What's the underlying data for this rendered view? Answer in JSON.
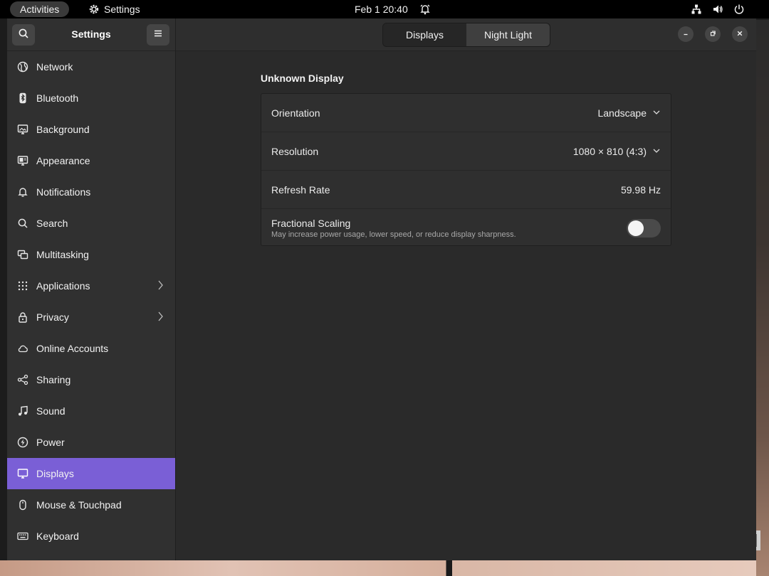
{
  "topbar": {
    "activities": "Activities",
    "app_name": "Settings",
    "clock": "Feb 1 20:40"
  },
  "sidebar": {
    "title": "Settings",
    "items": [
      {
        "label": "Network",
        "icon": "network-icon"
      },
      {
        "label": "Bluetooth",
        "icon": "bluetooth-icon"
      },
      {
        "label": "Background",
        "icon": "background-icon"
      },
      {
        "label": "Appearance",
        "icon": "appearance-icon"
      },
      {
        "label": "Notifications",
        "icon": "bell-icon"
      },
      {
        "label": "Search",
        "icon": "search-icon"
      },
      {
        "label": "Multitasking",
        "icon": "multitasking-icon"
      },
      {
        "label": "Applications",
        "icon": "apps-grid-icon"
      },
      {
        "label": "Privacy",
        "icon": "lock-icon"
      },
      {
        "label": "Online Accounts",
        "icon": "cloud-icon"
      },
      {
        "label": "Sharing",
        "icon": "share-icon"
      },
      {
        "label": "Sound",
        "icon": "music-note-icon"
      },
      {
        "label": "Power",
        "icon": "power-icon"
      },
      {
        "label": "Displays",
        "icon": "display-icon"
      },
      {
        "label": "Mouse & Touchpad",
        "icon": "mouse-icon"
      },
      {
        "label": "Keyboard",
        "icon": "keyboard-icon"
      }
    ],
    "active_item": "Displays"
  },
  "header": {
    "tabs": [
      "Displays",
      "Night Light"
    ],
    "selected_tab": "Displays"
  },
  "display": {
    "name": "Unknown Display",
    "orientation": {
      "label": "Orientation",
      "value": "Landscape"
    },
    "resolution": {
      "label": "Resolution",
      "value": "1080 × 810 (4:3)"
    },
    "refresh_rate": {
      "label": "Refresh Rate",
      "value": "59.98 Hz"
    },
    "fractional_scaling": {
      "label": "Fractional Scaling",
      "description": "May increase power usage, lower speed, or reduce display sharpness.",
      "enabled": false
    }
  },
  "colors": {
    "accent": "#7a5fd6",
    "window_bg": "#2a2a2a",
    "sidebar_bg": "#303030"
  }
}
